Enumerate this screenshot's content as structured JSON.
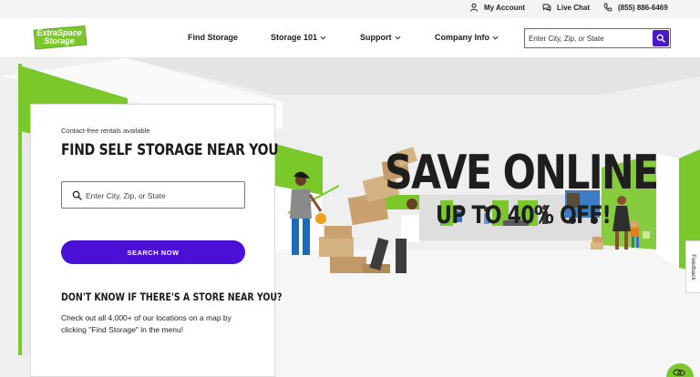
{
  "utility": {
    "account": "My Account",
    "chat": "Live Chat",
    "phone": "(855) 886-6469"
  },
  "logo": {
    "line1": "ExtraSpace",
    "line2": "Storage"
  },
  "nav": {
    "items": [
      {
        "label": "Find Storage",
        "has_dropdown": false
      },
      {
        "label": "Storage 101",
        "has_dropdown": true
      },
      {
        "label": "Support",
        "has_dropdown": true
      },
      {
        "label": "Company Info",
        "has_dropdown": true
      }
    ],
    "search_placeholder": "Enter City, Zip, or State"
  },
  "hero": {
    "headline": "SAVE ONLINE",
    "subheadline": "UP TO 40% OFF!"
  },
  "card": {
    "eyebrow": "Contact-free rentals available",
    "title": "FIND SELF STORAGE NEAR YOU",
    "search_placeholder": "Enter City, Zip, or State",
    "button": "SEARCH NOW",
    "subtitle": "DON'T KNOW IF THERE'S A STORE NEAR YOU?",
    "body": "Check out all 4,000+ of our locations on a map by clicking \"Find Storage\" in the menu!"
  },
  "feedback": "Feedback",
  "colors": {
    "brand_green": "#7ac82a",
    "accent_purple": "#4a10d6",
    "text_dark": "#1a1a1a"
  },
  "icons": [
    "user-icon",
    "chat-icon",
    "phone-icon",
    "chevron-down-icon",
    "search-icon",
    "chat-bubble-icon"
  ]
}
